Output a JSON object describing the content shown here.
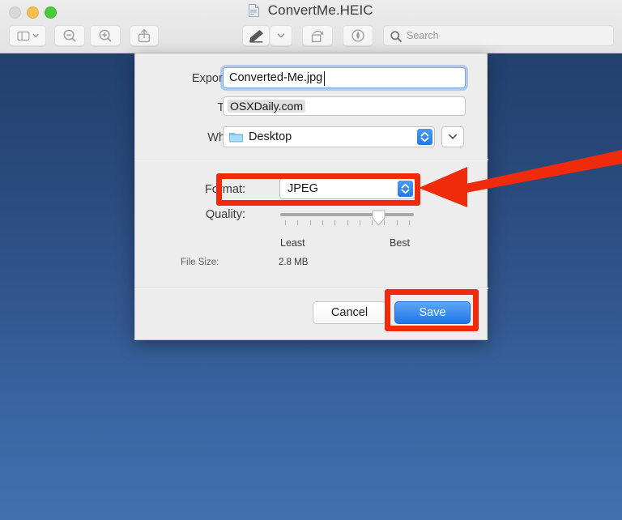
{
  "window": {
    "title": "ConvertMe.HEIC",
    "doc_icon": "document-icon",
    "traffic_lights": {
      "close": "close-button",
      "minimize": "minimize-button",
      "maximize": "maximize-button"
    }
  },
  "toolbar": {
    "sidebar_icon": "sidebar-toggle-icon",
    "sidebar_chevron_icon": "chevron-down-icon",
    "zoom_out_icon": "zoom-out-icon",
    "zoom_in_icon": "zoom-in-icon",
    "share_icon": "share-icon",
    "markup_icon": "markup-pen-icon",
    "markup_chevron_icon": "chevron-down-icon",
    "rotate_icon": "rotate-icon",
    "annotate_icon": "annotate-icon",
    "search_icon": "search-icon",
    "search_placeholder": "Search",
    "search_value": ""
  },
  "dialog": {
    "export_as": {
      "label": "Export As:",
      "value": "Converted-Me.jpg"
    },
    "tags": {
      "label": "Tags:",
      "value": "OSXDaily.com"
    },
    "where": {
      "label": "Where:",
      "value": "Desktop",
      "folder_icon": "folder-icon",
      "stepper_icon": "stepper-up-down-icon",
      "expand_icon": "chevron-down-icon"
    },
    "format": {
      "label": "Format:",
      "value": "JPEG",
      "stepper_icon": "stepper-up-down-icon"
    },
    "quality": {
      "label": "Quality:",
      "least_label": "Least",
      "best_label": "Best",
      "value_percent": 76,
      "tick_count": 11
    },
    "file_size": {
      "label": "File Size:",
      "value": "2.8 MB"
    },
    "buttons": {
      "cancel": "Cancel",
      "save": "Save"
    }
  },
  "annotations": {
    "format_highlight": "red-rectangle-format",
    "save_highlight": "red-rectangle-save",
    "arrow": "red-arrow-pointing-left",
    "color": "#ef2b0c"
  },
  "colors": {
    "accent_blue": "#1f76e6",
    "desktop_top": "#22406f",
    "desktop_bottom": "#4070ae",
    "annotation_red": "#ef2b0c",
    "sheet_background": "#ededed"
  }
}
